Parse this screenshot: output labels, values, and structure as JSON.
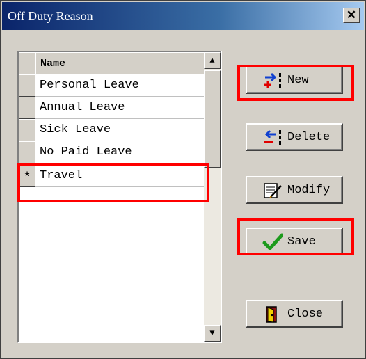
{
  "window": {
    "title": "Off Duty Reason",
    "close_glyph": "✕"
  },
  "grid": {
    "header": "Name",
    "rows": [
      {
        "indicator": "",
        "name": "Personal Leave"
      },
      {
        "indicator": "",
        "name": "Annual Leave"
      },
      {
        "indicator": "",
        "name": "Sick Leave"
      },
      {
        "indicator": "",
        "name": "No Paid Leave"
      },
      {
        "indicator": "*",
        "name": "Travel"
      }
    ],
    "scroll_up": "▲",
    "scroll_down": "▼"
  },
  "buttons": {
    "new": {
      "label": "New",
      "icon": "new-record-icon"
    },
    "delete": {
      "label": "Delete",
      "icon": "delete-record-icon"
    },
    "modify": {
      "label": "Modify",
      "icon": "modify-icon"
    },
    "save": {
      "label": "Save",
      "icon": "checkmark-icon"
    },
    "close": {
      "label": "Close",
      "icon": "door-exit-icon"
    }
  },
  "highlight_color": "#ff0000"
}
